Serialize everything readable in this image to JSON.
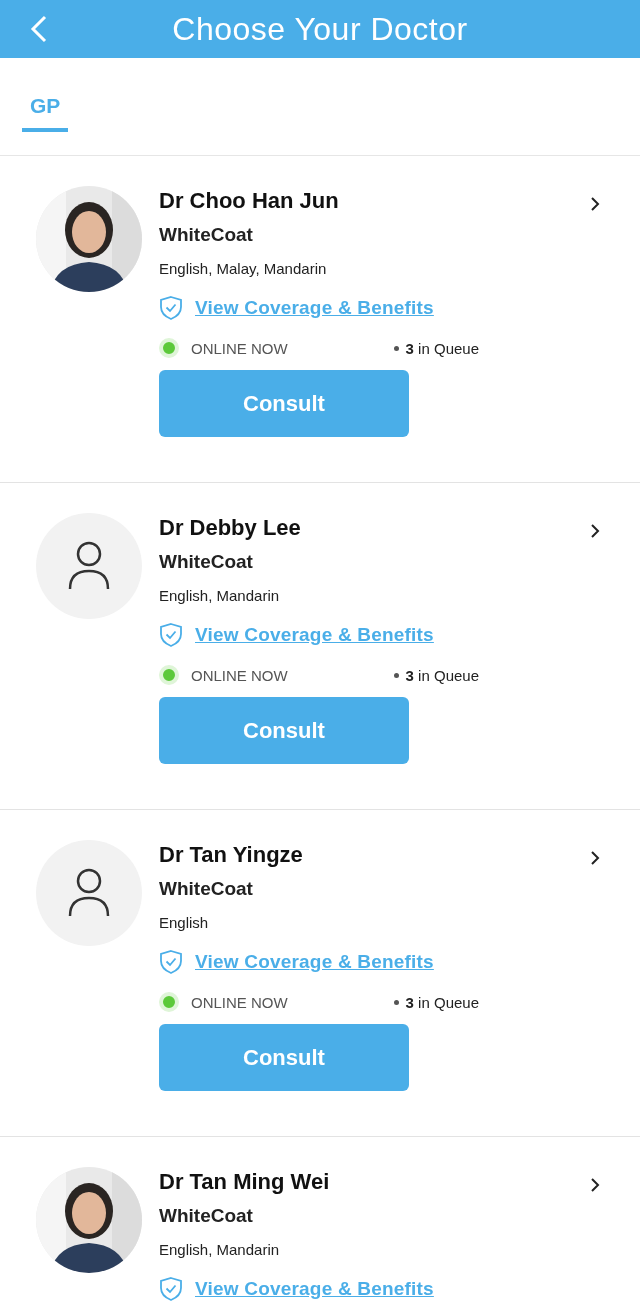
{
  "header": {
    "title": "Choose Your Doctor"
  },
  "tabs": [
    {
      "label": "GP",
      "selected": true
    }
  ],
  "doctors": [
    {
      "name": "Dr Choo Han Jun",
      "clinic": "WhiteCoat",
      "languages": "English, Malay, Mandarin",
      "link": "View Coverage & Benefits",
      "online": true,
      "status": "ONLINE NOW",
      "queue": "**3** in Queue",
      "button": "Consult"
    },
    {
      "name": "Dr Debby Lee",
      "clinic": "WhiteCoat",
      "languages": "English, Mandarin",
      "link": "View Coverage & Benefits",
      "online": true,
      "status": "ONLINE NOW",
      "queue": "**3** in Queue",
      "button": "Consult",
      "avatar": {
        "kind": "placeholder"
      }
    },
    {
      "name": "Dr Tan Yingze",
      "clinic": "WhiteCoat",
      "languages": "English",
      "link": "View Coverage & Benefits",
      "online": true,
      "status": "ONLINE NOW",
      "queue": "**3** in Queue",
      "button": "Consult",
      "avatar": {
        "kind": "placeholder"
      }
    },
    {
      "name": "Dr Tan Ming Wei",
      "clinic": "WhiteCoat",
      "languages": "English, Mandarin",
      "link": "View Coverage & Benefits"
    }
  ]
}
